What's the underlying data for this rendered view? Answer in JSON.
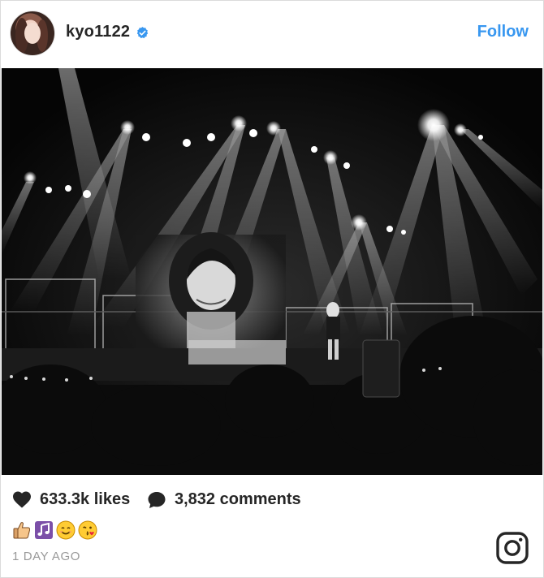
{
  "header": {
    "username": "kyo1122",
    "verified_icon": "verified-badge-icon",
    "follow_label": "Follow"
  },
  "photo": {
    "icon": "concert-stage-photo"
  },
  "actions": {
    "like_icon": "heart-icon",
    "likes_text": "633.3k likes",
    "comment_icon": "comment-bubble-icon",
    "comments_text": "3,832 comments"
  },
  "reactions": [
    "thumbs-up-icon",
    "music-notes-icon",
    "smiling-face-icon",
    "kissing-face-icon"
  ],
  "timestamp": "1 DAY AGO",
  "brand_icon": "instagram-logo-icon",
  "colors": {
    "accent": "#3897f0",
    "text": "#262626",
    "muted": "#999999",
    "verified": "#3897f0"
  }
}
